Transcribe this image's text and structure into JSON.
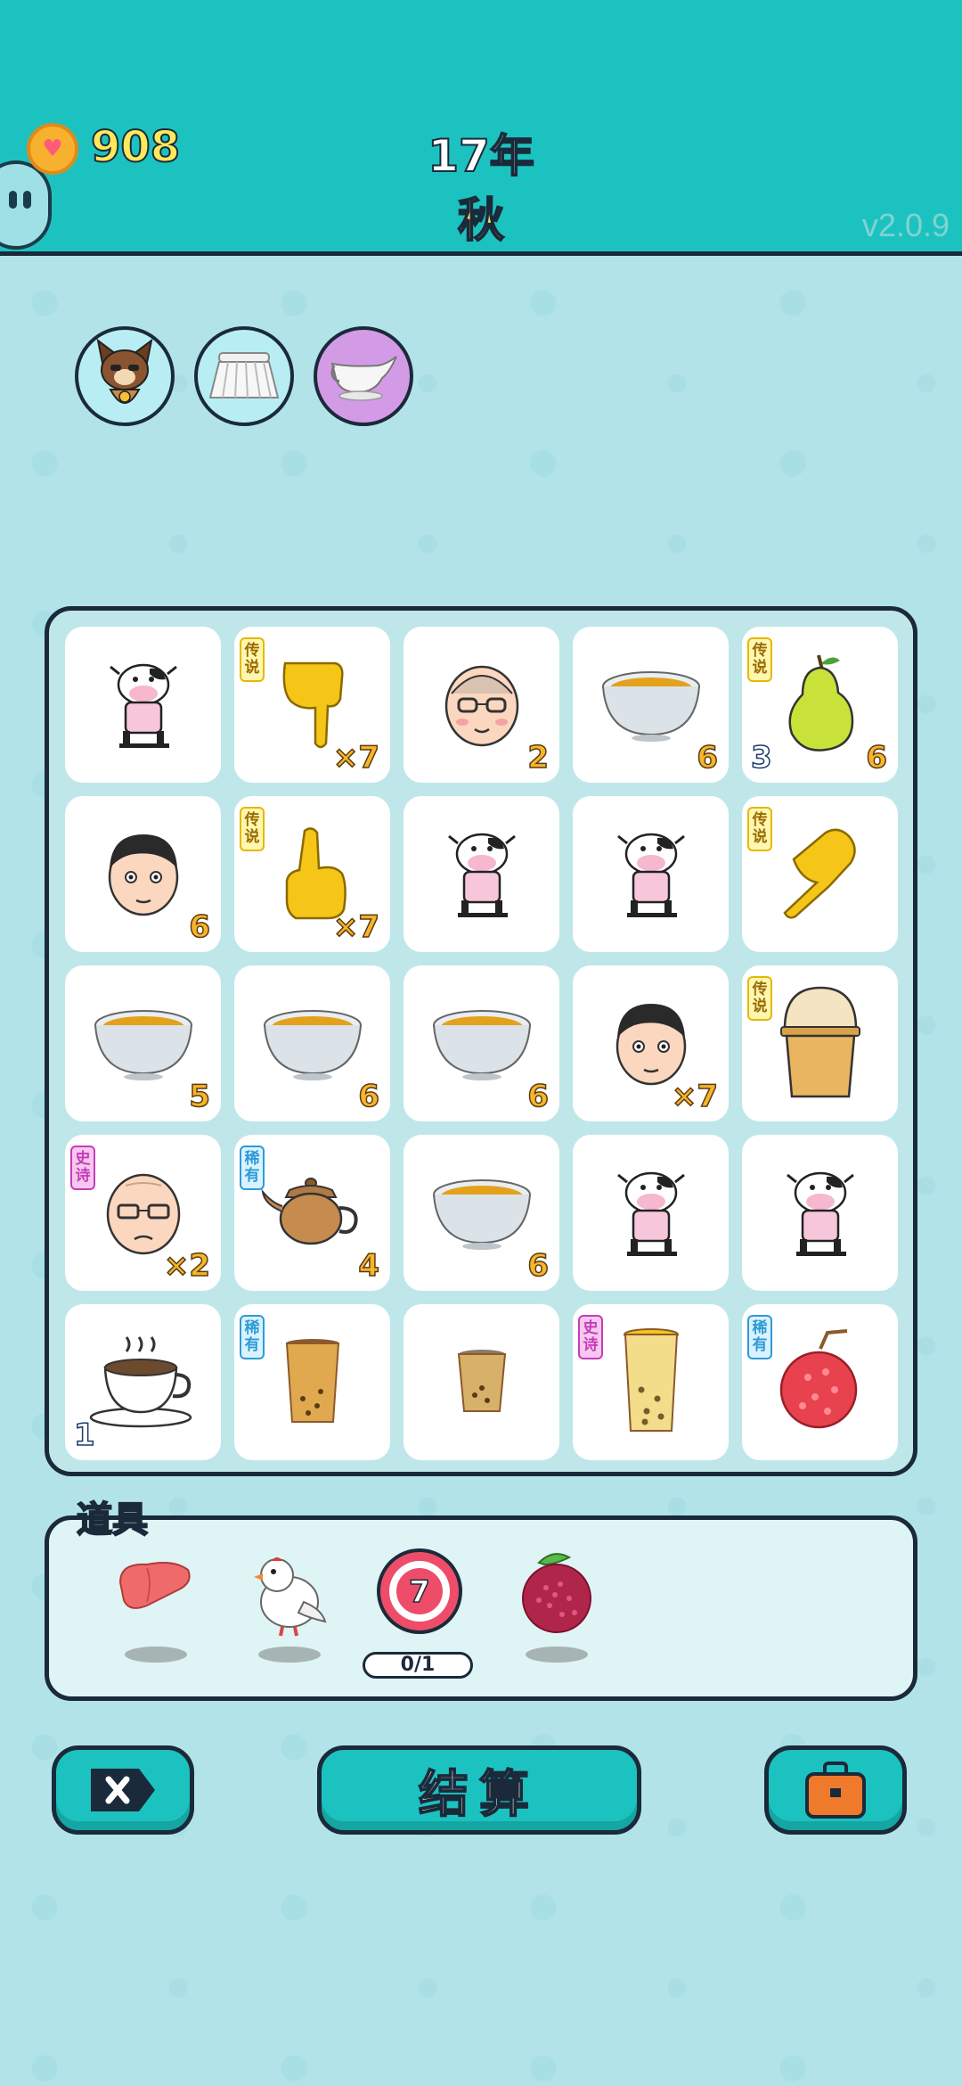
{
  "header": {
    "coins": "908",
    "year": "17年",
    "season": "秋",
    "version": "v2.0.9"
  },
  "top_items": [
    {
      "icon": "cat-dog-icon",
      "bg": "#b8eef3"
    },
    {
      "icon": "skirt-icon",
      "bg": "#b8eef3"
    },
    {
      "icon": "gravy-boat-icon",
      "bg": "#d39be6"
    }
  ],
  "board": {
    "cells": [
      {
        "icon": "cow-icon",
        "badge": "",
        "qty": "",
        "left_qty": ""
      },
      {
        "icon": "pointing-down-hand-icon",
        "badge": "传说",
        "qty": "×7",
        "left_qty": ""
      },
      {
        "icon": "old-man-glasses-face-icon",
        "badge": "",
        "qty": "2",
        "left_qty": ""
      },
      {
        "icon": "soup-bowl-icon",
        "badge": "",
        "qty": "6",
        "left_qty": ""
      },
      {
        "icon": "pear-icon",
        "badge": "传说",
        "qty": "6",
        "left_qty": "3"
      },
      {
        "icon": "man-face-icon",
        "badge": "",
        "qty": "6",
        "left_qty": ""
      },
      {
        "icon": "pointing-up-hand-icon",
        "badge": "传说",
        "qty": "×7",
        "left_qty": ""
      },
      {
        "icon": "cow-icon",
        "badge": "",
        "qty": "",
        "left_qty": ""
      },
      {
        "icon": "cow-icon",
        "badge": "",
        "qty": "",
        "left_qty": ""
      },
      {
        "icon": "pointing-diagonal-hand-icon",
        "badge": "传说",
        "qty": "",
        "left_qty": ""
      },
      {
        "icon": "soup-bowl-icon",
        "badge": "",
        "qty": "5",
        "left_qty": ""
      },
      {
        "icon": "soup-bowl-icon",
        "badge": "",
        "qty": "6",
        "left_qty": ""
      },
      {
        "icon": "soup-bowl-icon",
        "badge": "",
        "qty": "6",
        "left_qty": ""
      },
      {
        "icon": "man-face-icon",
        "badge": "",
        "qty": "×7",
        "left_qty": ""
      },
      {
        "icon": "dome-cup-icon",
        "badge": "传说",
        "qty": "",
        "left_qty": ""
      },
      {
        "icon": "bald-old-man-face-icon",
        "badge": "史诗",
        "qty": "×2",
        "left_qty": ""
      },
      {
        "icon": "teapot-icon",
        "badge": "稀有",
        "qty": "4",
        "left_qty": ""
      },
      {
        "icon": "soup-bowl-icon",
        "badge": "",
        "qty": "6",
        "left_qty": ""
      },
      {
        "icon": "cow-icon",
        "badge": "",
        "qty": "",
        "left_qty": ""
      },
      {
        "icon": "cow-icon",
        "badge": "",
        "qty": "",
        "left_qty": ""
      },
      {
        "icon": "coffee-cup-icon",
        "badge": "",
        "qty": "",
        "left_qty": "1"
      },
      {
        "icon": "milk-tea-cup-icon",
        "badge": "稀有",
        "qty": "",
        "left_qty": ""
      },
      {
        "icon": "small-milk-tea-cup-icon",
        "badge": "",
        "qty": "",
        "left_qty": ""
      },
      {
        "icon": "tall-milk-tea-cup-icon",
        "badge": "史诗",
        "qty": "",
        "left_qty": ""
      },
      {
        "icon": "lychee-icon",
        "badge": "稀有",
        "qty": "",
        "left_qty": ""
      }
    ]
  },
  "props": {
    "title": "道具",
    "items": [
      {
        "icon": "liver-icon"
      },
      {
        "icon": "white-bird-icon"
      },
      {
        "icon": "target-seven-icon",
        "value": "7",
        "counter": "0/1"
      },
      {
        "icon": "bayberry-icon"
      }
    ]
  },
  "buttons": {
    "close_icon": "close-tag-icon",
    "settle_label": "结算",
    "bag_icon": "briefcase-icon"
  },
  "colors": {
    "header": "#1cc2c0",
    "background": "#b2e3e8",
    "board": "#bfe7ea",
    "qty": "#f6b52a"
  }
}
